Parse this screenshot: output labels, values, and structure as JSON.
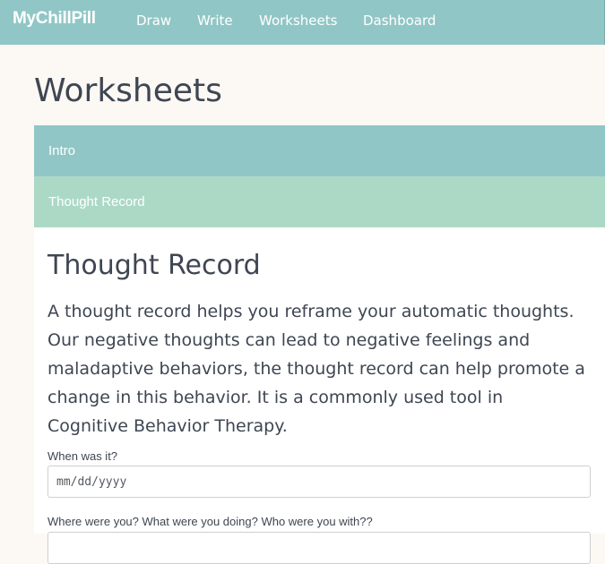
{
  "navbar": {
    "brand": "MyChillPill",
    "links": [
      {
        "label": "Draw"
      },
      {
        "label": "Write"
      },
      {
        "label": "Worksheets"
      },
      {
        "label": "Dashboard"
      }
    ]
  },
  "page": {
    "title": "Worksheets"
  },
  "accordion": {
    "panels": [
      {
        "label": "Intro"
      },
      {
        "label": "Thought Record"
      }
    ]
  },
  "thought_record": {
    "title": "Thought Record",
    "description": "A thought record helps you reframe your automatic thoughts. Our negative thoughts can lead to negative feelings and maladaptive behaviors, the thought record can help promote a change in this behavior. It is a commonly used tool in Cognitive Behavior Therapy.",
    "fields": [
      {
        "label": "When was it?",
        "placeholder": "mm/dd/yyyy"
      },
      {
        "label": "Where were you? What were you doing? Who were you with??"
      }
    ]
  },
  "colors": {
    "navbar": "#91c6c6",
    "intro_panel": "#91c6c6",
    "thought_panel": "#acd9c6",
    "background": "#fcf8f3",
    "text": "#3e4652"
  }
}
